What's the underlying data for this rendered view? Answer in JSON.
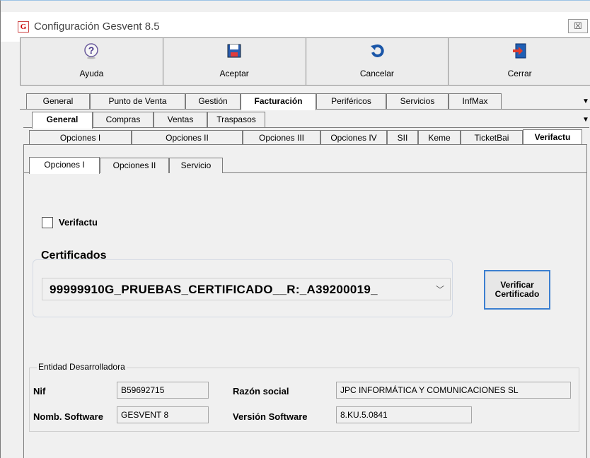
{
  "window": {
    "title": "Configuración Gesvent 8.5",
    "close_label": "☒"
  },
  "toolbar": [
    {
      "label": "Ayuda",
      "icon": "help-icon"
    },
    {
      "label": "Aceptar",
      "icon": "save-icon"
    },
    {
      "label": "Cancelar",
      "icon": "undo-icon"
    },
    {
      "label": "Cerrar",
      "icon": "exit-icon"
    }
  ],
  "tabs_level1": [
    "General",
    "Punto de Venta",
    "Gestión",
    "Facturación",
    "Periféricos",
    "Servicios",
    "InfMax"
  ],
  "tabs_level2": [
    "General",
    "Compras",
    "Ventas",
    "Traspasos"
  ],
  "tabs_level3": [
    "Opciones I",
    "Opciones II",
    "Opciones III",
    "Opciones IV",
    "SII",
    "Keme",
    "TicketBai",
    "Verifactu"
  ],
  "tabs_level4": [
    "Opciones I",
    "Opciones II",
    "Servicio"
  ],
  "verifactu": {
    "label": "Verifactu",
    "checked": false
  },
  "certificados": {
    "title": "Certificados",
    "selected": "99999910G_PRUEBAS_CERTIFICADO__R:_A39200019_",
    "verify_button_line1": "Verificar",
    "verify_button_line2": "Certificado"
  },
  "entidad": {
    "legend": "Entidad Desarrolladora",
    "nif_label": "Nif",
    "nif_value": "B59692715",
    "razon_label": "Razón social",
    "razon_value": "JPC INFORMÁTICA Y COMUNICACIONES SL",
    "nomb_label": "Nomb. Software",
    "nomb_value": "GESVENT 8",
    "version_label": "Versión Software",
    "version_value": "8.KU.5.0841"
  }
}
